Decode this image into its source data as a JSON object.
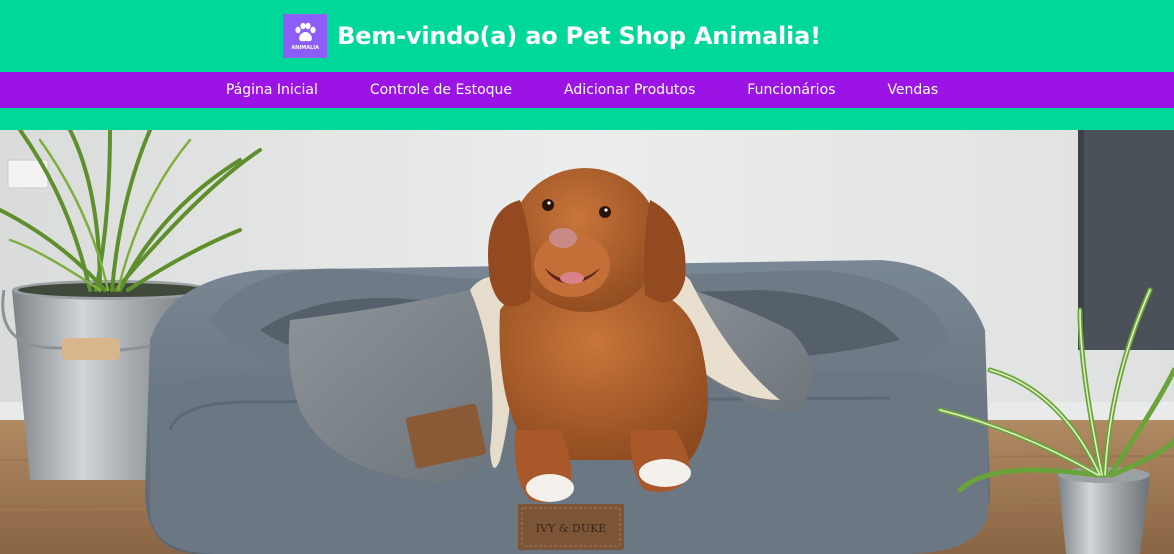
{
  "header": {
    "title": "Bem-vindo(a) ao Pet Shop Animalia!",
    "logo_text": "ANIMALIA"
  },
  "nav": {
    "items": [
      {
        "label": "Página Inicial"
      },
      {
        "label": "Controle de Estoque"
      },
      {
        "label": "Adicionar Produtos"
      },
      {
        "label": "Funcionários"
      },
      {
        "label": "Vendas"
      }
    ]
  },
  "hero": {
    "bed_label": "IVY & DUKE"
  },
  "colors": {
    "header_bg": "#00d89a",
    "nav_bg": "#9b13e5",
    "logo_bg": "#8e5cf6"
  }
}
